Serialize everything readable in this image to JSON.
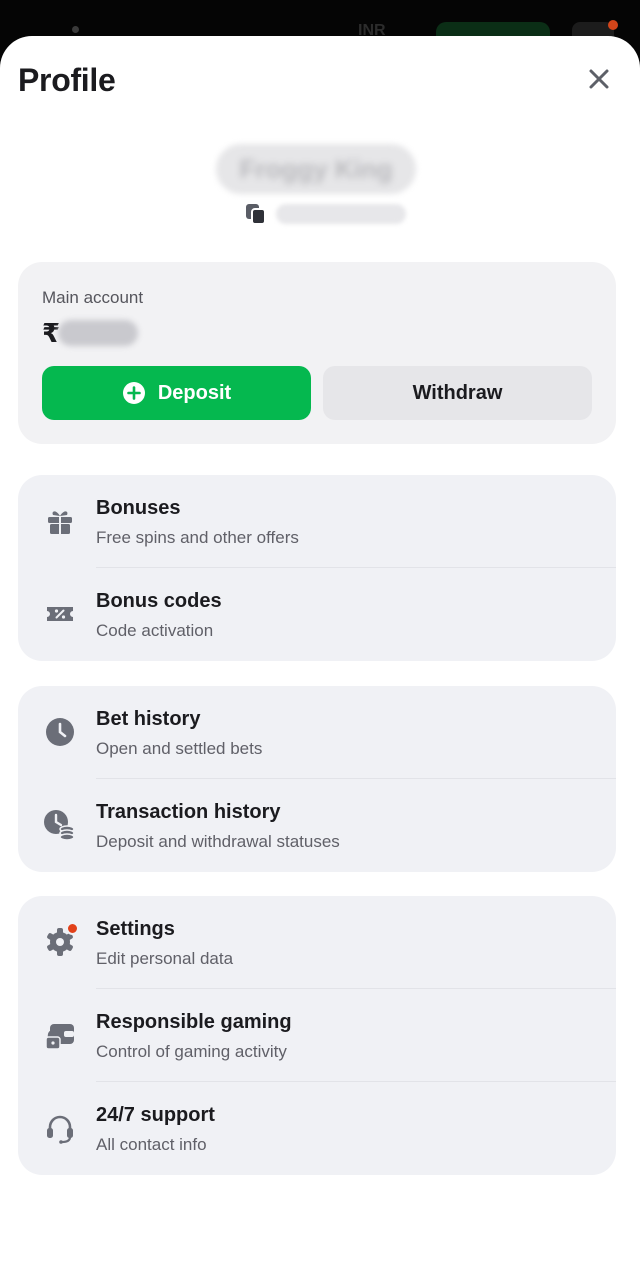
{
  "background": {
    "currency": "INR"
  },
  "header": {
    "title": "Profile"
  },
  "account": {
    "label": "Main account",
    "currency_symbol": "₹",
    "deposit_label": "Deposit",
    "withdraw_label": "Withdraw"
  },
  "menu": {
    "bonuses": {
      "title": "Bonuses",
      "subtitle": "Free spins and other offers"
    },
    "bonus_codes": {
      "title": "Bonus codes",
      "subtitle": "Code activation"
    },
    "bet_history": {
      "title": "Bet history",
      "subtitle": "Open and settled bets"
    },
    "transaction_history": {
      "title": "Transaction history",
      "subtitle": "Deposit and withdrawal statuses"
    },
    "settings": {
      "title": "Settings",
      "subtitle": "Edit personal data"
    },
    "responsible_gaming": {
      "title": "Responsible gaming",
      "subtitle": "Control of gaming activity"
    },
    "support": {
      "title": "24/7 support",
      "subtitle": "All contact info"
    }
  },
  "colors": {
    "accent_green": "#05b84f",
    "badge_red": "#e2411a",
    "icon_gray": "#6b6e78"
  },
  "icons": {
    "close": "close-icon",
    "copy": "copy-icon",
    "plus": "plus-circle-icon",
    "bonuses": "gift-icon",
    "bonus_codes": "ticket-percent-icon",
    "bet_history": "clock-icon",
    "transaction_history": "clock-coins-icon",
    "settings": "gear-icon",
    "responsible_gaming": "wallet-lock-icon",
    "support": "headset-icon"
  }
}
